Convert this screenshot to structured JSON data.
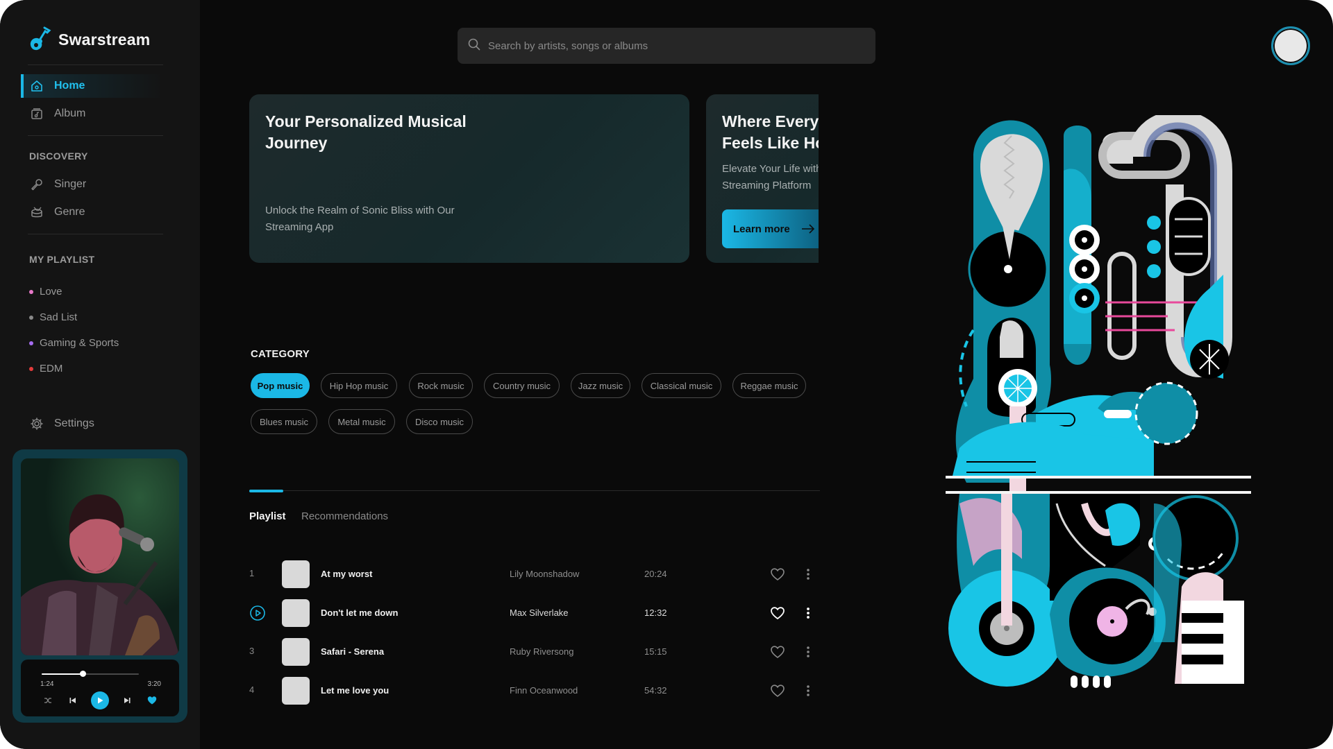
{
  "app": {
    "name": "Swarstream"
  },
  "nav": {
    "home": "Home",
    "album": "Album",
    "discovery_label": "DISCOVERY",
    "singer": "Singer",
    "genre": "Genre",
    "playlist_label": "MY PLAYLIST",
    "settings": "Settings"
  },
  "playlists": [
    {
      "label": "Love",
      "color": "#e879c9"
    },
    {
      "label": "Sad List",
      "color": "#8a8a8a"
    },
    {
      "label": "Gaming & Sports",
      "color": "#a56cf0"
    },
    {
      "label": "EDM",
      "color": "#e43b3b"
    }
  ],
  "player": {
    "elapsed": "1:24",
    "total": "3:20",
    "progress": 0.42
  },
  "search": {
    "placeholder": "Search by artists, songs or albums"
  },
  "hero": [
    {
      "title": "Your Personalized Musical Journey",
      "text": "Unlock the Realm of Sonic Bliss with Our Streaming App"
    },
    {
      "title": "Where Every Beat Feels Like Home",
      "text": "Elevate Your Life with Music Streaming Platform",
      "button": "Learn more"
    }
  ],
  "category": {
    "title": "CATEGORY",
    "chips": [
      "Pop music",
      "Hip Hop music",
      "Rock music",
      "Country music",
      "Jazz music",
      "Classical music",
      "Reggae music",
      "Blues music",
      "Metal music",
      "Disco music"
    ],
    "active": "Pop music"
  },
  "tabs": [
    "Playlist",
    "Recommendations"
  ],
  "songs": [
    {
      "num": "1",
      "title": "At my worst",
      "artist": "Lily Moonshadow",
      "duration": "20:24"
    },
    {
      "num": "2",
      "title": "Don't let me down",
      "artist": "Max Silverlake",
      "duration": "12:32",
      "playing": true
    },
    {
      "num": "3",
      "title": "Safari - Serena",
      "artist": "Ruby Riversong",
      "duration": "15:15"
    },
    {
      "num": "4",
      "title": "Let me love you",
      "artist": "Finn Oceanwood",
      "duration": "54:32"
    }
  ],
  "colors": {
    "accent": "#1bb8e6",
    "background": "#0a0a0a",
    "sidebar": "#141414",
    "player": "#0f3a45"
  }
}
